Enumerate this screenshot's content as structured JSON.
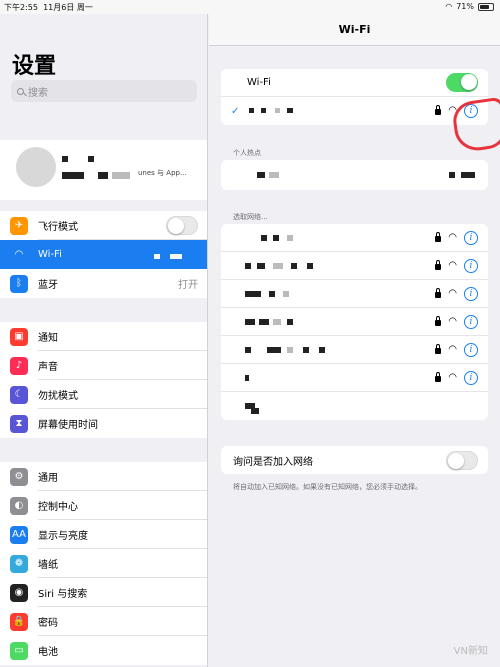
{
  "status_bar": {
    "time": "下午2:55",
    "date": "11月6日 周一",
    "battery": "71%",
    "battery_fill": 0.71
  },
  "sidebar": {
    "title": "设置",
    "search_placeholder": "搜索",
    "account_subtitle": "unes 与 App...",
    "groups": [
      {
        "items": [
          {
            "label": "飞行模式",
            "icon": "airplane-icon",
            "color": "#ff9500",
            "glyph": "✈",
            "toggle": "off"
          },
          {
            "label": "Wi-Fi",
            "icon": "wifi-icon",
            "color": "#1a7ef0",
            "glyph": "◠",
            "active": true
          },
          {
            "label": "蓝牙",
            "icon": "bluetooth-icon",
            "color": "#1a7ef0",
            "glyph": "ᛒ",
            "value": "打开"
          }
        ]
      },
      {
        "items": [
          {
            "label": "通知",
            "icon": "notifications-icon",
            "color": "#ff3b30",
            "glyph": "▣"
          },
          {
            "label": "声音",
            "icon": "sound-icon",
            "color": "#ff2d55",
            "glyph": "♪"
          },
          {
            "label": "勿扰模式",
            "icon": "moon-icon",
            "color": "#5856d6",
            "glyph": "☾"
          },
          {
            "label": "屏幕使用时间",
            "icon": "hourglass-icon",
            "color": "#5856d6",
            "glyph": "⧗"
          }
        ]
      },
      {
        "items": [
          {
            "label": "通用",
            "icon": "gear-icon",
            "color": "#8e8e93",
            "glyph": "⚙"
          },
          {
            "label": "控制中心",
            "icon": "control-center-icon",
            "color": "#8e8e93",
            "glyph": "◐"
          },
          {
            "label": "显示与亮度",
            "icon": "display-icon",
            "color": "#1a7ef0",
            "glyph": "AA"
          },
          {
            "label": "墙纸",
            "icon": "wallpaper-icon",
            "color": "#34aadc",
            "glyph": "❁"
          },
          {
            "label": "Siri 与搜索",
            "icon": "siri-icon",
            "color": "#222222",
            "glyph": "◉"
          },
          {
            "label": "密码",
            "icon": "lock-icon",
            "color": "#ff3b30",
            "glyph": "🔒"
          },
          {
            "label": "电池",
            "icon": "battery-icon",
            "color": "#4cd964",
            "glyph": "▭"
          }
        ]
      }
    ]
  },
  "wifi_panel": {
    "nav_title": "Wi-Fi",
    "wifi_label": "Wi-Fi",
    "wifi_on": true,
    "hotspot_label": "个人热点",
    "choose_label": "选取网络...",
    "ask_join_label": "询问是否加入网络",
    "ask_join_on": false,
    "ask_join_note": "将自动加入已知网络。如果没有已知网络，您必须手动选择。",
    "network_count": 7
  },
  "watermark": "VN新知",
  "colors": {
    "accent": "#1a7ef0",
    "toggle_on": "#4cd964",
    "annotation": "#e8323c"
  }
}
